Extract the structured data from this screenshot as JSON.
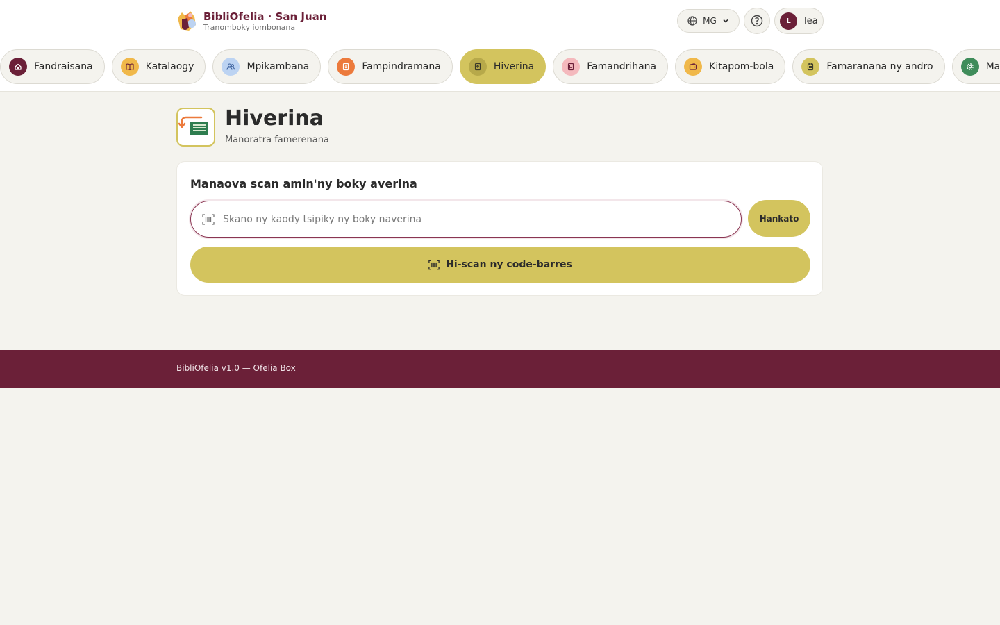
{
  "header": {
    "brand_title": "BibliOfelia · San Juan",
    "brand_subtitle": "Tranomboky iombonana",
    "language": "MG",
    "user": {
      "initial": "L",
      "name": "lea"
    }
  },
  "nav": {
    "items": [
      {
        "label": "Fandraisana",
        "icon": "home-icon",
        "color": "#6b2038",
        "active": false
      },
      {
        "label": "Katalaogy",
        "icon": "book-open-icon",
        "color": "#f0b84a",
        "active": false
      },
      {
        "label": "Mpikambana",
        "icon": "users-icon",
        "color": "#bcd3f2",
        "active": false
      },
      {
        "label": "Fampindramana",
        "icon": "book-out-icon",
        "color": "#ec7a3c",
        "active": false
      },
      {
        "label": "Hiverina",
        "icon": "book-return-icon",
        "color": "#b7a94a",
        "active": true
      },
      {
        "label": "Famandrihana",
        "icon": "bookmark-icon",
        "color": "#f4b9bd",
        "active": false
      },
      {
        "label": "Kitapom-bola",
        "icon": "wallet-icon",
        "color": "#f0b84a",
        "active": false
      },
      {
        "label": "Famaranana ny andro",
        "icon": "clipboard-icon",
        "color": "#d3c45e",
        "active": false
      },
      {
        "label": "Mandrο",
        "icon": "settings-icon",
        "color": "#3f8c5a",
        "active": false
      }
    ]
  },
  "page": {
    "title": "Hiverina",
    "subtitle": "Manoratra famerenana",
    "icon": "return-book-icon"
  },
  "card": {
    "title": "Manaova scan amin'ny boky averina",
    "input_placeholder": "Skano ny kaody tsipiky ny boky naverina",
    "input_value": "",
    "submit_label": "Hankato",
    "scan_label": "Hi-scan ny code-barres"
  },
  "footer": {
    "text": "BibliOfelia v1.0 — Ofelia Box"
  },
  "colors": {
    "brand": "#6b2038",
    "accent": "#d3c45e",
    "background": "#f4f3ee"
  }
}
